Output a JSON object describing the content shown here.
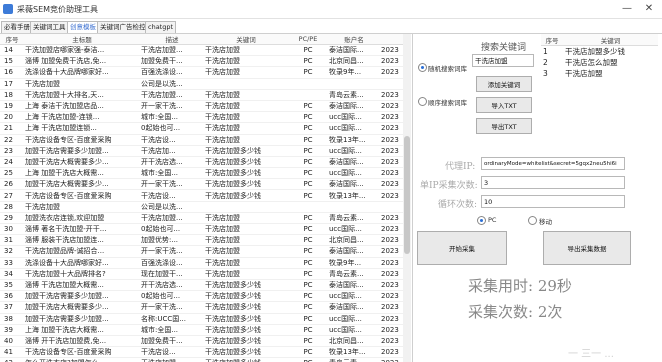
{
  "window": {
    "title": "采薇SEM竞价助理工具",
    "minimize": "—",
    "close": "✕"
  },
  "tabs": [
    {
      "label": "必看手册"
    },
    {
      "label": "关键词工具"
    },
    {
      "label": "创意模板"
    },
    {
      "label": "关键词广告检控"
    },
    {
      "label": "chatgpt"
    }
  ],
  "grid": {
    "headers": [
      "序号",
      "主标题",
      "描述",
      "关键词",
      "PC/PE",
      "账户名",
      ""
    ],
    "rows": [
      [
        "14",
        "干洗加盟店哪家强-泰洁...",
        "干洗店加盟...",
        "干洗店加盟",
        "PC",
        "泰洁国际...",
        "2023"
      ],
      [
        "15",
        "淄博 加盟免费干洗店,免...",
        "加盟免费干...",
        "干洗店加盟",
        "PC",
        "北京同昌...",
        "2023"
      ],
      [
        "16",
        "洗涤设备十大品牌哪家好...",
        "百强洗涤设...",
        "干洗店加盟",
        "PC",
        "牧录9年...",
        "2023"
      ],
      [
        "17",
        "干洗店加盟",
        "公司是以洗...",
        "",
        "",
        "",
        ""
      ],
      [
        "18",
        "干洗店加盟十大排名,天...",
        "干洗店加盟...",
        "干洗店加盟",
        "",
        "青岛云素...",
        "2023"
      ],
      [
        "19",
        "上海 泰洁干洗加盟店品...",
        "开一家干洗...",
        "干洗店加盟",
        "PC",
        "泰洁国际...",
        "2023"
      ],
      [
        "20",
        "上海 干洗店加盟-连锁...",
        "城市:全国...",
        "干洗店加盟",
        "PC",
        "ucc国际...",
        "2023"
      ],
      [
        "21",
        "上海 干洗店加盟连锁...",
        "0起始也可...",
        "干洗店加盟",
        "PC",
        "ucc国际...",
        "2023"
      ],
      [
        "22",
        "干洗店设备专区-百度爱采购",
        "干洗店设...",
        "干洗店加盟",
        "PC",
        "牧录13年...",
        "2023"
      ],
      [
        "23",
        "加盟干洗店需要多少加盟...",
        "干洗店加...",
        "干洗店加盟多少钱",
        "PC",
        "ucc国际...",
        "2023"
      ],
      [
        "24",
        "加盟干洗店大概需要多少...",
        "开干洗店选...",
        "干洗店加盟多少钱",
        "PC",
        "泰洁国际...",
        "2023"
      ],
      [
        "25",
        "上海 加盟干洗店大概需...",
        "城市:全国...",
        "干洗店加盟多少钱",
        "PC",
        "ucc国际...",
        "2023"
      ],
      [
        "26",
        "加盟干洗店大概需要多少...",
        "开一家干洗...",
        "干洗店加盟多少钱",
        "PC",
        "泰洁国际...",
        "2023"
      ],
      [
        "27",
        "干洗店设备专区-百度爱采购",
        "干洗店设...",
        "干洗店加盟多少钱",
        "PC",
        "牧录13年...",
        "2023"
      ],
      [
        "28",
        "干洗店加盟",
        "公司是以洗...",
        "",
        "",
        "",
        ""
      ],
      [
        "29",
        "加盟洗衣店连锁,欢迎加盟",
        "干洗店加盟...",
        "干洗店加盟",
        "PC",
        "青岛云素...",
        "2023"
      ],
      [
        "30",
        "淄博 著名干洗加盟-开干...",
        "0起始也可...",
        "干洗店加盟",
        "PC",
        "ucc国际...",
        "2023"
      ],
      [
        "31",
        "淄博 服装干洗店加盟连...",
        "加盟优势:...",
        "干洗店加盟",
        "PC",
        "北京同昌...",
        "2023"
      ],
      [
        "32",
        "干洗店加盟品牌-诚招合...",
        "开一家干洗...",
        "干洗店加盟",
        "PC",
        "泰洁国际...",
        "2023"
      ],
      [
        "33",
        "洗涤设备十大品牌哪家好...",
        "百强洗涤设...",
        "干洗店加盟",
        "PC",
        "牧录9年...",
        "2023"
      ],
      [
        "34",
        "干洗店加盟十大品牌排名?",
        "现在加盟干...",
        "干洗店加盟",
        "PC",
        "青岛云素...",
        "2023"
      ],
      [
        "35",
        "淄博 干洗店加盟大概需...",
        "开干洗店选...",
        "干洗店加盟多少钱",
        "PC",
        "泰洁国际...",
        "2023"
      ],
      [
        "36",
        "加盟干洗店需要多少加盟...",
        "0起始也可...",
        "干洗店加盟多少钱",
        "PC",
        "ucc国际...",
        "2023"
      ],
      [
        "37",
        "加盟干洗店大概需要多少...",
        "开一家干洗...",
        "干洗店加盟多少钱",
        "PC",
        "泰洁国际...",
        "2023"
      ],
      [
        "38",
        "加盟干洗店需要多少加盟...",
        "名称:UCC国...",
        "干洗店加盟多少钱",
        "PC",
        "ucc国际...",
        "2023"
      ],
      [
        "39",
        "上海 加盟干洗店大概需...",
        "城市:全国...",
        "干洗店加盟多少钱",
        "PC",
        "ucc国际...",
        "2023"
      ],
      [
        "40",
        "淄博 开干洗店加盟费,免...",
        "加盟免费干...",
        "干洗店加盟多少钱",
        "PC",
        "北京同昌...",
        "2023"
      ],
      [
        "41",
        "干洗店设备专区-百度爱采购",
        "干洗店设...",
        "干洗店加盟多少钱",
        "PC",
        "牧录13年...",
        "2023"
      ],
      [
        "42",
        "怎么开洗衣店?加盟怎么...",
        "干洗店加盟...",
        "干洗店加盟多少钱",
        "PC",
        "青岛云素...",
        "2023"
      ]
    ]
  },
  "search_panel": {
    "heading": "搜索关键词",
    "mode_random": "随机搜索词库",
    "mode_order": "顺序搜索词库",
    "keyword_value": "干洗店加盟",
    "add_button": "添加关键词",
    "import_button": "导入TXT",
    "export_button": "导出TXT"
  },
  "keyword_table": {
    "headers": [
      "序号",
      "关键词"
    ],
    "rows": [
      [
        "1",
        "干洗店加盟多少钱"
      ],
      [
        "2",
        "干洗店怎么加盟"
      ],
      [
        "3",
        "干洗店加盟"
      ]
    ]
  },
  "proxy_form": {
    "proxy_label": "代理IP:",
    "proxy_value": "ordinaryMode=whitelist&secret=5gqx2neu5hi6i",
    "per_ip_label": "单IP采集次数:",
    "per_ip_value": "3",
    "loop_label": "循环次数:",
    "loop_value": "10",
    "device_pc": "PC",
    "device_mobile": "移动",
    "start_button": "开始采集",
    "export_data_button": "导出采集数据"
  },
  "stats": {
    "time_text": "采集用时: 29秒",
    "count_text": "采集次数: 2次"
  },
  "watermark": "一 三一 ..."
}
